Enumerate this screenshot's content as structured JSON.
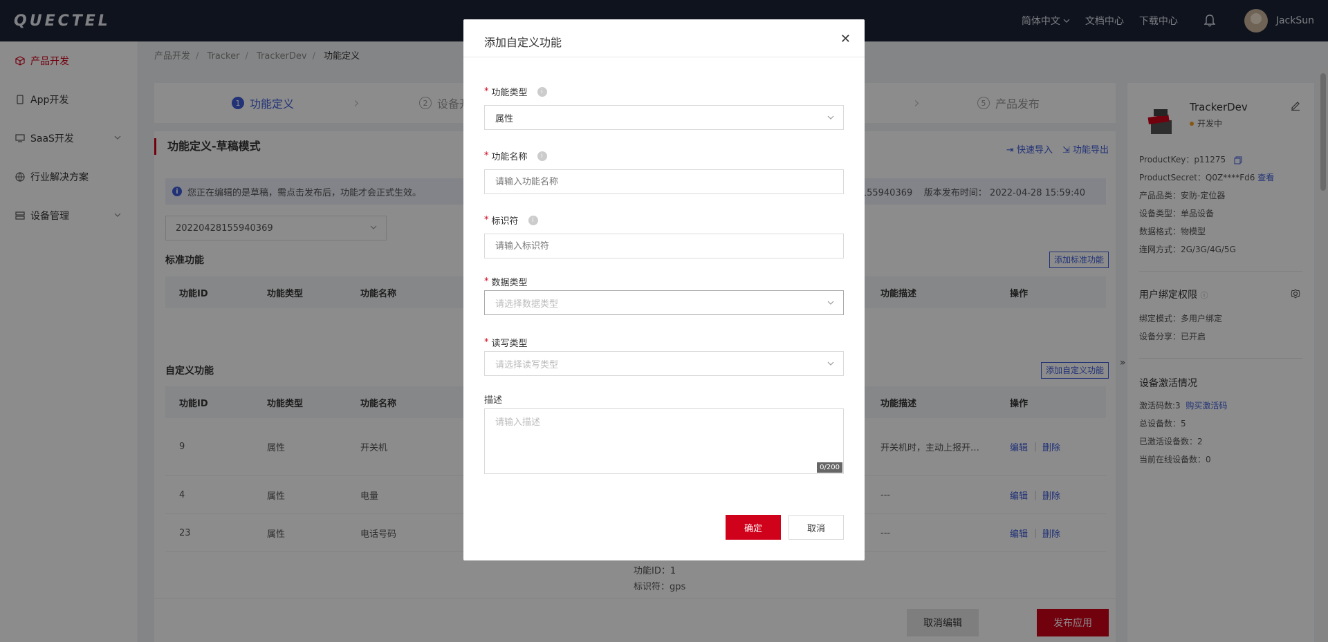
{
  "topbar": {
    "logo": "QUECTEL",
    "language": "简体中文",
    "docs": "文档中心",
    "downloads": "下载中心",
    "username": "JackSun"
  },
  "sidebar": {
    "items": [
      {
        "label": "产品开发",
        "active": true
      },
      {
        "label": "App开发"
      },
      {
        "label": "SaaS开发"
      },
      {
        "label": "行业解决方案"
      },
      {
        "label": "设备管理"
      }
    ]
  },
  "breadcrumb": [
    "产品开发",
    "Tracker",
    "TrackerDev",
    "功能定义"
  ],
  "steps": [
    {
      "num": "1",
      "label": "功能定义"
    },
    {
      "num": "2",
      "label": "设备开"
    },
    {
      "num": "5",
      "label": "产品发布"
    }
  ],
  "panel": {
    "title": "功能定义-草稿模式",
    "quick_import": "快速导入",
    "export": "功能导出",
    "notice": "您正在编辑的是草稿，需点击发布后，功能才会正式生效。",
    "notice_right_version": "155940369",
    "notice_right_time": "版本发布时间：  2022-04-28 15:59:40",
    "version_value": "20220428155940369",
    "standard_label": "标准功能",
    "add_standard": "添加标准功能",
    "custom_label": "自定义功能",
    "add_custom": "添加自定义功能",
    "columns": {
      "id": "功能ID",
      "type": "功能类型",
      "name": "功能名称",
      "desc": "功能描述",
      "ops": "操作"
    },
    "rows": [
      {
        "id": "9",
        "type": "属性",
        "name": "开关机",
        "desc": "开关机时，主动上报开…",
        "edit": "编辑",
        "sep": "|",
        "del": "删除"
      },
      {
        "id": "4",
        "type": "属性",
        "name": "电量",
        "desc": "---",
        "edit": "编辑",
        "sep": "|",
        "del": "删除"
      },
      {
        "id": "23",
        "type": "属性",
        "name": "电话号码",
        "desc": "---",
        "edit": "编辑",
        "sep": "|",
        "del": "删除"
      }
    ],
    "extra_line1": "功能ID：1",
    "extra_line2": "标识符：gps"
  },
  "bottom": {
    "cancel_edit": "取消编辑",
    "publish": "发布应用"
  },
  "info": {
    "name": "TrackerDev",
    "status": "开发中",
    "product_key": "ProductKey：p11275",
    "product_secret": "ProductSecret：Q0Z****Fd6",
    "view": "查看",
    "category": "产品品类：安防-定位器",
    "device_type": "设备类型：单品设备",
    "data_format": "数据格式：物模型",
    "network": "连网方式：2G/3G/4G/5G",
    "bind_title": "用户绑定权限",
    "bind_mode": "绑定模式：多用户绑定",
    "share": "设备分享：已开启",
    "activation_title": "设备激活情况",
    "activation_code": "激活码数:3",
    "buy": "购买激活码",
    "total": "总设备数：5",
    "activated": "已激活设备数：2",
    "online": "当前在线设备数：0"
  },
  "modal": {
    "title": "添加自定义功能",
    "type_label": "功能类型",
    "type_value": "属性",
    "name_label": "功能名称",
    "name_placeholder": "请输入功能名称",
    "id_label": "标识符",
    "id_placeholder": "请输入标识符",
    "data_type_label": "数据类型",
    "data_type_placeholder": "请选择数据类型",
    "rw_label": "读写类型",
    "rw_placeholder": "请选择读写类型",
    "desc_label": "描述",
    "desc_placeholder": "请输入描述",
    "counter": "0/200",
    "confirm": "确定",
    "cancel": "取消"
  }
}
